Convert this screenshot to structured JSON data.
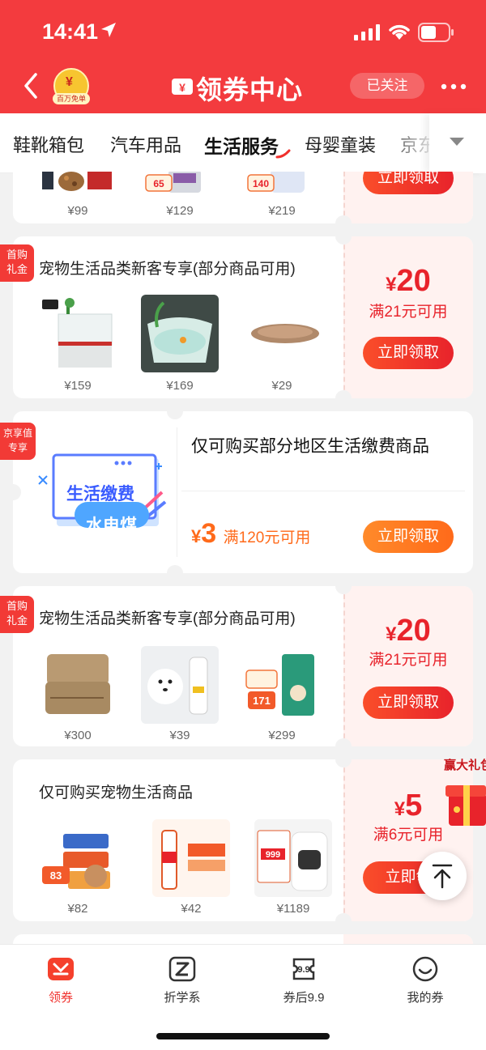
{
  "status_bar": {
    "time": "14:41"
  },
  "header": {
    "title": "领券中心",
    "avatar_text": "¥",
    "avatar_badge": "百万免单",
    "follow_label": "已关注"
  },
  "tabs": [
    {
      "label": "鞋靴箱包"
    },
    {
      "label": "汽车用品"
    },
    {
      "label": "生活服务",
      "active": true
    },
    {
      "label": "母婴童装"
    },
    {
      "label": "京东"
    }
  ],
  "cards": [
    {
      "title": "",
      "prices": [
        "¥99",
        "¥129",
        "¥219"
      ],
      "badges": [
        "65",
        "140"
      ],
      "claim_label": "立即领取"
    },
    {
      "tag": "首购\n礼金",
      "title": "宠物生活品类新客专享(部分商品可用)",
      "prices": [
        "¥159",
        "¥169",
        "¥29"
      ],
      "amount_yen": "¥",
      "amount": "20",
      "condition": "满21元可用",
      "claim_label": "立即领取"
    },
    {
      "tag": "京享值\n专享",
      "title": "仅可购买部分地区生活缴费商品",
      "image_title": "生活缴费",
      "image_sub": "水电煤",
      "amount_yen": "¥",
      "amount": "3",
      "condition": "满120元可用",
      "claim_label": "立即领取"
    },
    {
      "tag": "首购\n礼金",
      "title": "宠物生活品类新客专享(部分商品可用)",
      "prices": [
        "¥300",
        "¥39",
        "¥299"
      ],
      "badges": [
        "171"
      ],
      "amount_yen": "¥",
      "amount": "20",
      "condition": "满21元可用",
      "claim_label": "立即领取"
    },
    {
      "title": "仅可购买宠物生活商品",
      "prices": [
        "¥82",
        "¥42",
        "¥1189"
      ],
      "badges": [
        "83",
        "999"
      ],
      "amount_yen": "¥",
      "amount": "5",
      "condition": "满6元可用",
      "claim_label": "立即领"
    }
  ],
  "float": {
    "prize_label": "赢大礼包"
  },
  "bottom_nav": [
    {
      "label": "领券",
      "icon": "coupon-icon",
      "active": true
    },
    {
      "label": "折学系",
      "icon": "z-icon"
    },
    {
      "label": "券后9.9",
      "icon": "nine-icon"
    },
    {
      "label": "我的券",
      "icon": "smile-icon"
    }
  ],
  "colors": {
    "brand_red": "#f33b3e",
    "accent_red": "#e8232b",
    "orange": "#ff7a1a"
  }
}
